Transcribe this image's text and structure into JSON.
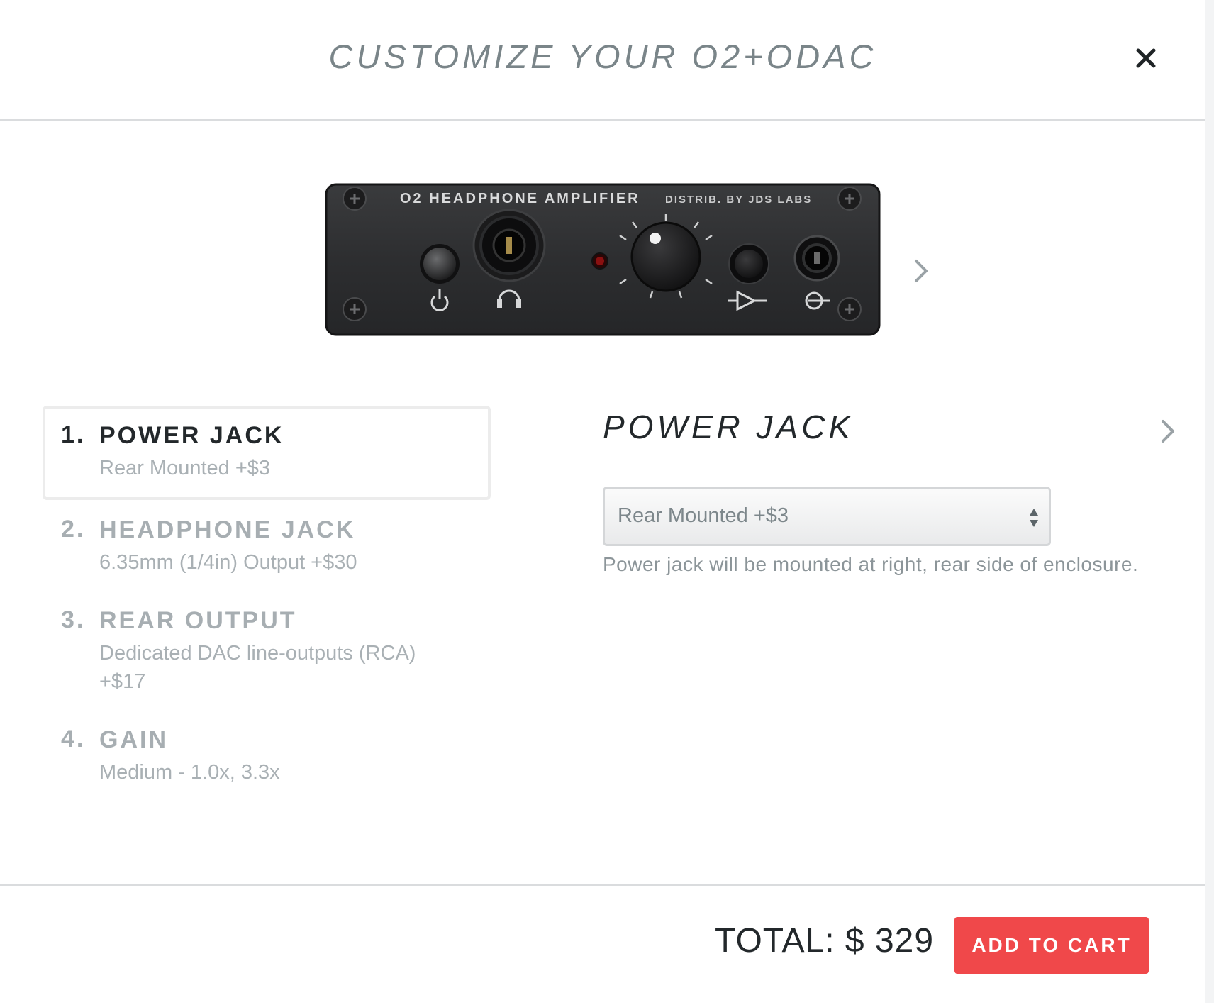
{
  "modal": {
    "title": "CUSTOMIZE YOUR O2+ODAC",
    "close_icon": "close-icon"
  },
  "product_image": {
    "panel_label_left": "O2 HEADPHONE AMPLIFIER",
    "panel_label_right": "DISTRIB. BY JDS LABS",
    "next_icon": "chevron-right-icon"
  },
  "steps": [
    {
      "number": "1.",
      "title": "POWER JACK",
      "value": "Rear Mounted +$3",
      "active": true
    },
    {
      "number": "2.",
      "title": "HEADPHONE JACK",
      "value": "6.35mm (1/4in) Output +$30",
      "active": false
    },
    {
      "number": "3.",
      "title": "REAR OUTPUT",
      "value": "Dedicated DAC line-outputs (RCA) +$17",
      "active": false
    },
    {
      "number": "4.",
      "title": "GAIN",
      "value": "Medium - 1.0x, 3.3x",
      "active": false
    }
  ],
  "detail": {
    "title": "POWER JACK",
    "select_value": "Rear Mounted +$3",
    "description": "Power jack will be mounted at right, rear side of enclosure.",
    "next_icon": "chevron-right-icon"
  },
  "footer": {
    "total_text": "TOTAL: $ 329",
    "add_to_cart_label": "ADD TO CART"
  },
  "colors": {
    "accent": "#f0484a",
    "title_gray": "#7a8589",
    "dark_text": "#23282b",
    "muted_text": "#a7aeb2"
  }
}
